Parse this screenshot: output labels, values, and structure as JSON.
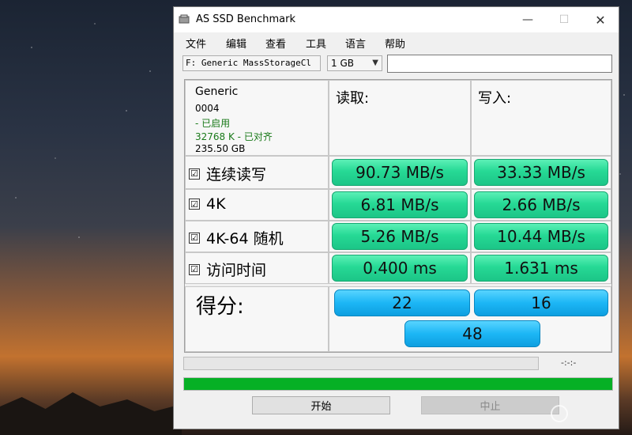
{
  "window": {
    "title": "AS SSD Benchmark"
  },
  "menu": [
    "文件",
    "编辑",
    "查看",
    "工具",
    "语言",
    "帮助"
  ],
  "toolbar": {
    "drive": "F: Generic MassStorageCl",
    "size": "1 GB",
    "path": ""
  },
  "device_info": {
    "name": "Generic",
    "firmware": "0004",
    "status1": " - 已启用",
    "status2": "32768 K - 已对齐",
    "capacity": "235.50 GB"
  },
  "columns": {
    "read": "读取:",
    "write": "写入:"
  },
  "rows": [
    {
      "label": "连续读写",
      "checked": "☑",
      "read": "90.73 MB/s",
      "write": "33.33 MB/s"
    },
    {
      "label": "4K",
      "checked": "☑",
      "read": "6.81 MB/s",
      "write": "2.66 MB/s"
    },
    {
      "label": "4K-64 随机",
      "checked": "☑",
      "read": "5.26 MB/s",
      "write": "10.44 MB/s"
    },
    {
      "label": "访问时间",
      "checked": "☑",
      "read": "0.400 ms",
      "write": "1.631 ms"
    }
  ],
  "score": {
    "label": "得分:",
    "read": "22",
    "write": "16",
    "total": "48"
  },
  "progress": {
    "time": "-:-:-",
    "main_fraction": 1.0
  },
  "buttons": {
    "start": "开始",
    "stop": "中止"
  },
  "colors": {
    "result_green": "#26d995",
    "score_blue": "#1cb6f5",
    "progress_green": "#06b025"
  }
}
